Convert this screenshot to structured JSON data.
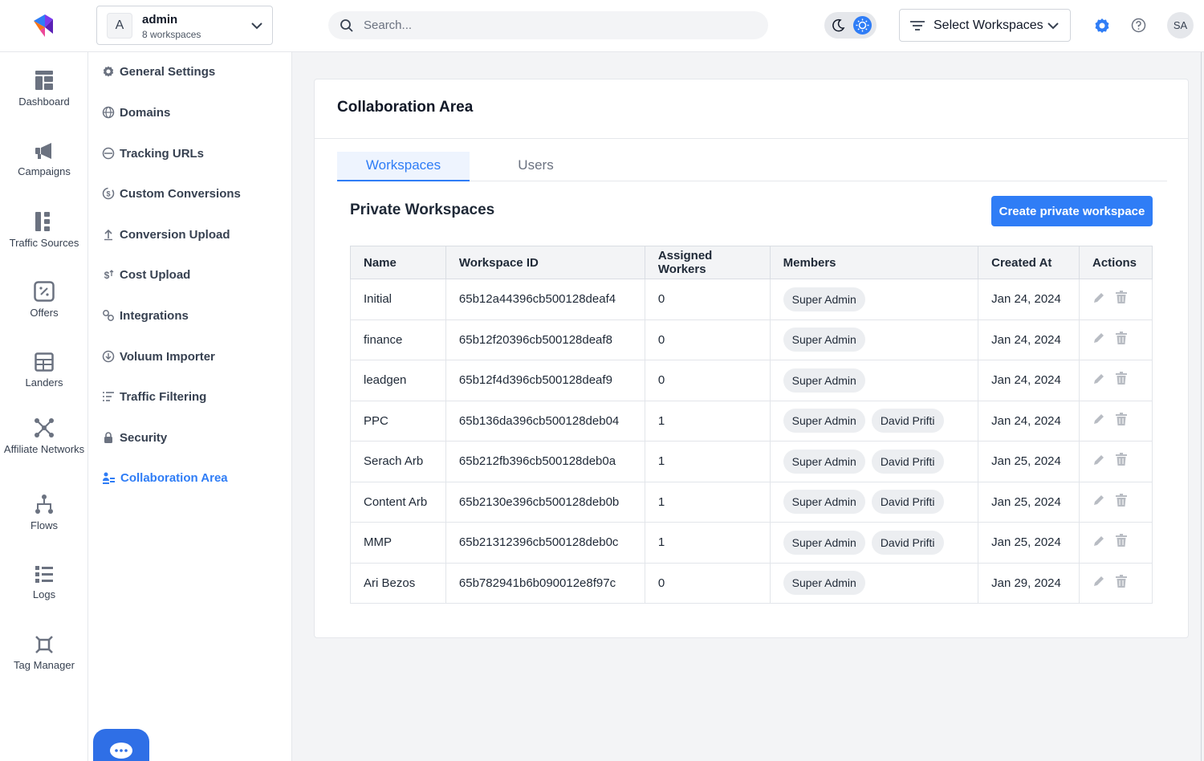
{
  "account": {
    "avatar_letter": "A",
    "name": "admin",
    "workspaces_count": "8 workspaces"
  },
  "search": {
    "placeholder": "Search..."
  },
  "workspace_select": {
    "label": "Select Workspaces"
  },
  "user": {
    "initials": "SA"
  },
  "left_nav": [
    {
      "label": "Dashboard",
      "icon": "dashboard-icon"
    },
    {
      "label": "Campaigns",
      "icon": "megaphone-icon"
    },
    {
      "label": "Traffic Sources",
      "icon": "traffic-sources-icon"
    },
    {
      "label": "Offers",
      "icon": "offers-icon"
    },
    {
      "label": "Landers",
      "icon": "landers-icon"
    },
    {
      "label": "Affiliate Networks",
      "icon": "affiliate-networks-icon"
    },
    {
      "label": "Flows",
      "icon": "flows-icon"
    },
    {
      "label": "Logs",
      "icon": "logs-icon"
    },
    {
      "label": "Tag Manager",
      "icon": "tag-manager-icon"
    }
  ],
  "settings_menu": [
    {
      "label": "General Settings",
      "icon": "gear-icon"
    },
    {
      "label": "Domains",
      "icon": "globe-icon"
    },
    {
      "label": "Tracking URLs",
      "icon": "www-icon"
    },
    {
      "label": "Custom Conversions",
      "icon": "dollar-cycle-icon"
    },
    {
      "label": "Conversion Upload",
      "icon": "upload-icon"
    },
    {
      "label": "Cost Upload",
      "icon": "dollar-upload-icon"
    },
    {
      "label": "Integrations",
      "icon": "integrations-icon"
    },
    {
      "label": "Voluum Importer",
      "icon": "importer-icon"
    },
    {
      "label": "Traffic Filtering",
      "icon": "filter-list-icon"
    },
    {
      "label": "Security",
      "icon": "lock-icon"
    },
    {
      "label": "Collaboration Area",
      "icon": "collaboration-icon",
      "active": true
    }
  ],
  "page": {
    "title": "Collaboration Area",
    "tabs": [
      "Workspaces",
      "Users"
    ],
    "section_title": "Private Workspaces",
    "create_button": "Create private workspace"
  },
  "table": {
    "headers": [
      "Name",
      "Workspace ID",
      "Assigned Workers",
      "Members",
      "Created At",
      "Actions"
    ],
    "rows": [
      {
        "name": "Initial",
        "id": "65b12a44396cb500128deaf4",
        "workers": "0",
        "members": [
          "Super Admin"
        ],
        "created": "Jan 24, 2024"
      },
      {
        "name": "finance",
        "id": "65b12f20396cb500128deaf8",
        "workers": "0",
        "members": [
          "Super Admin"
        ],
        "created": "Jan 24, 2024"
      },
      {
        "name": "leadgen",
        "id": "65b12f4d396cb500128deaf9",
        "workers": "0",
        "members": [
          "Super Admin"
        ],
        "created": "Jan 24, 2024"
      },
      {
        "name": "PPC",
        "id": "65b136da396cb500128deb04",
        "workers": "1",
        "members": [
          "Super Admin",
          "David Prifti"
        ],
        "created": "Jan 24, 2024"
      },
      {
        "name": "Serach Arb",
        "id": "65b212fb396cb500128deb0a",
        "workers": "1",
        "members": [
          "Super Admin",
          "David Prifti"
        ],
        "created": "Jan 25, 2024"
      },
      {
        "name": "Content Arb",
        "id": "65b2130e396cb500128deb0b",
        "workers": "1",
        "members": [
          "Super Admin",
          "David Prifti"
        ],
        "created": "Jan 25, 2024"
      },
      {
        "name": "MMP",
        "id": "65b21312396cb500128deb0c",
        "workers": "1",
        "members": [
          "Super Admin",
          "David Prifti"
        ],
        "created": "Jan 25, 2024"
      },
      {
        "name": "Ari Bezos",
        "id": "65b782941b6b090012e8f97c",
        "workers": "0",
        "members": [
          "Super Admin"
        ],
        "created": "Jan 29, 2024"
      }
    ]
  },
  "colors": {
    "accent": "#2f7df6",
    "chip": "#eceef1",
    "header_bg": "#f3f4f6"
  }
}
